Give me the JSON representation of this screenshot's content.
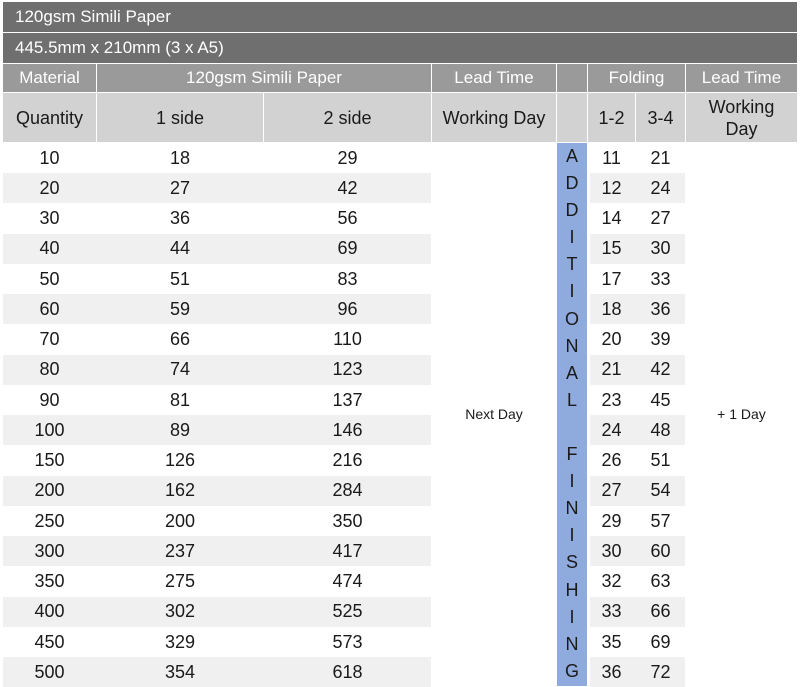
{
  "title_bar": "120gsm Simili Paper",
  "size_bar": "445.5mm x 210mm (3 x A5)",
  "header_row1": {
    "material": "Material",
    "paper": "120gsm Simili Paper",
    "lead_time": "Lead Time",
    "blank": "",
    "folding": "Folding",
    "lead_time2": "Lead Time"
  },
  "header_row2": {
    "quantity": "Quantity",
    "one_side": "1 side",
    "two_side": "2 side",
    "working_day": "Working Day",
    "blank": "",
    "fold_12": "1-2",
    "fold_34": "3-4",
    "working_day2": "Working Day"
  },
  "lead_time_value": "Next Day",
  "folding_lead_value": "+ 1 Day",
  "additional_finishing": [
    "A",
    "D",
    "D",
    "I",
    "T",
    "I",
    "O",
    "N",
    "A",
    "L",
    "",
    "F",
    "I",
    "N",
    "I",
    "S",
    "H",
    "I",
    "N",
    "G"
  ],
  "rows": [
    {
      "qty": "10",
      "one": "18",
      "two": "29",
      "f12": "11",
      "f34": "21"
    },
    {
      "qty": "20",
      "one": "27",
      "two": "42",
      "f12": "12",
      "f34": "24"
    },
    {
      "qty": "30",
      "one": "36",
      "two": "56",
      "f12": "14",
      "f34": "27"
    },
    {
      "qty": "40",
      "one": "44",
      "two": "69",
      "f12": "15",
      "f34": "30"
    },
    {
      "qty": "50",
      "one": "51",
      "two": "83",
      "f12": "17",
      "f34": "33"
    },
    {
      "qty": "60",
      "one": "59",
      "two": "96",
      "f12": "18",
      "f34": "36"
    },
    {
      "qty": "70",
      "one": "66",
      "two": "110",
      "f12": "20",
      "f34": "39"
    },
    {
      "qty": "80",
      "one": "74",
      "two": "123",
      "f12": "21",
      "f34": "42"
    },
    {
      "qty": "90",
      "one": "81",
      "two": "137",
      "f12": "23",
      "f34": "45"
    },
    {
      "qty": "100",
      "one": "89",
      "two": "146",
      "f12": "24",
      "f34": "48"
    },
    {
      "qty": "150",
      "one": "126",
      "two": "216",
      "f12": "26",
      "f34": "51"
    },
    {
      "qty": "200",
      "one": "162",
      "two": "284",
      "f12": "27",
      "f34": "54"
    },
    {
      "qty": "250",
      "one": "200",
      "two": "350",
      "f12": "29",
      "f34": "57"
    },
    {
      "qty": "300",
      "one": "237",
      "two": "417",
      "f12": "30",
      "f34": "60"
    },
    {
      "qty": "350",
      "one": "275",
      "two": "474",
      "f12": "32",
      "f34": "63"
    },
    {
      "qty": "400",
      "one": "302",
      "two": "525",
      "f12": "33",
      "f34": "66"
    },
    {
      "qty": "450",
      "one": "329",
      "two": "573",
      "f12": "35",
      "f34": "69"
    },
    {
      "qty": "500",
      "one": "354",
      "two": "618",
      "f12": "36",
      "f34": "72"
    }
  ]
}
